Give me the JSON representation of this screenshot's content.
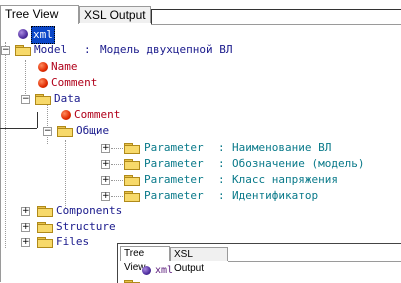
{
  "tabs": [
    {
      "label": "Tree View",
      "active": true
    },
    {
      "label": "XSL Output",
      "active": false
    }
  ],
  "tree": {
    "root": {
      "label": "xml",
      "selected": true
    },
    "model": {
      "name": "Model",
      "sep": ":",
      "value": "Модель двухцепной ВЛ"
    },
    "model_children": [
      {
        "label": "Name",
        "kind": "attribute"
      },
      {
        "label": "Comment",
        "kind": "attribute"
      }
    ],
    "data": {
      "label": "Data"
    },
    "data_children": [
      {
        "label": "Comment",
        "kind": "attribute"
      }
    ],
    "common": {
      "label": "Общие"
    },
    "parameters": [
      {
        "name": "Parameter",
        "sep": ":",
        "value": "Наименование ВЛ"
      },
      {
        "name": "Parameter",
        "sep": ":",
        "value": "Обозначение (модель)"
      },
      {
        "name": "Parameter",
        "sep": ":",
        "value": "Класс напряжения"
      },
      {
        "name": "Parameter",
        "sep": ":",
        "value": "Идентификатор"
      }
    ],
    "top_level": [
      {
        "label": "Components"
      },
      {
        "label": "Structure"
      },
      {
        "label": "Files"
      }
    ]
  },
  "inset": {
    "tabs": [
      {
        "label": "Tree View",
        "active": true
      },
      {
        "label": "XSL Output",
        "active": false
      }
    ],
    "root": {
      "label": "xml"
    }
  },
  "colors": {
    "attribute_dot": "#e02a00",
    "root_dot": "#4f2ea0",
    "element_text": "#1a1a8c",
    "attribute_text": "#b0001a",
    "value_text": "#0a7a8a",
    "selection": "#0a46c8"
  },
  "icons": {
    "element": "folder-icon",
    "attribute": "red-dot-icon",
    "root": "purple-dot-icon",
    "expand": "plus-icon",
    "collapse": "minus-icon"
  }
}
